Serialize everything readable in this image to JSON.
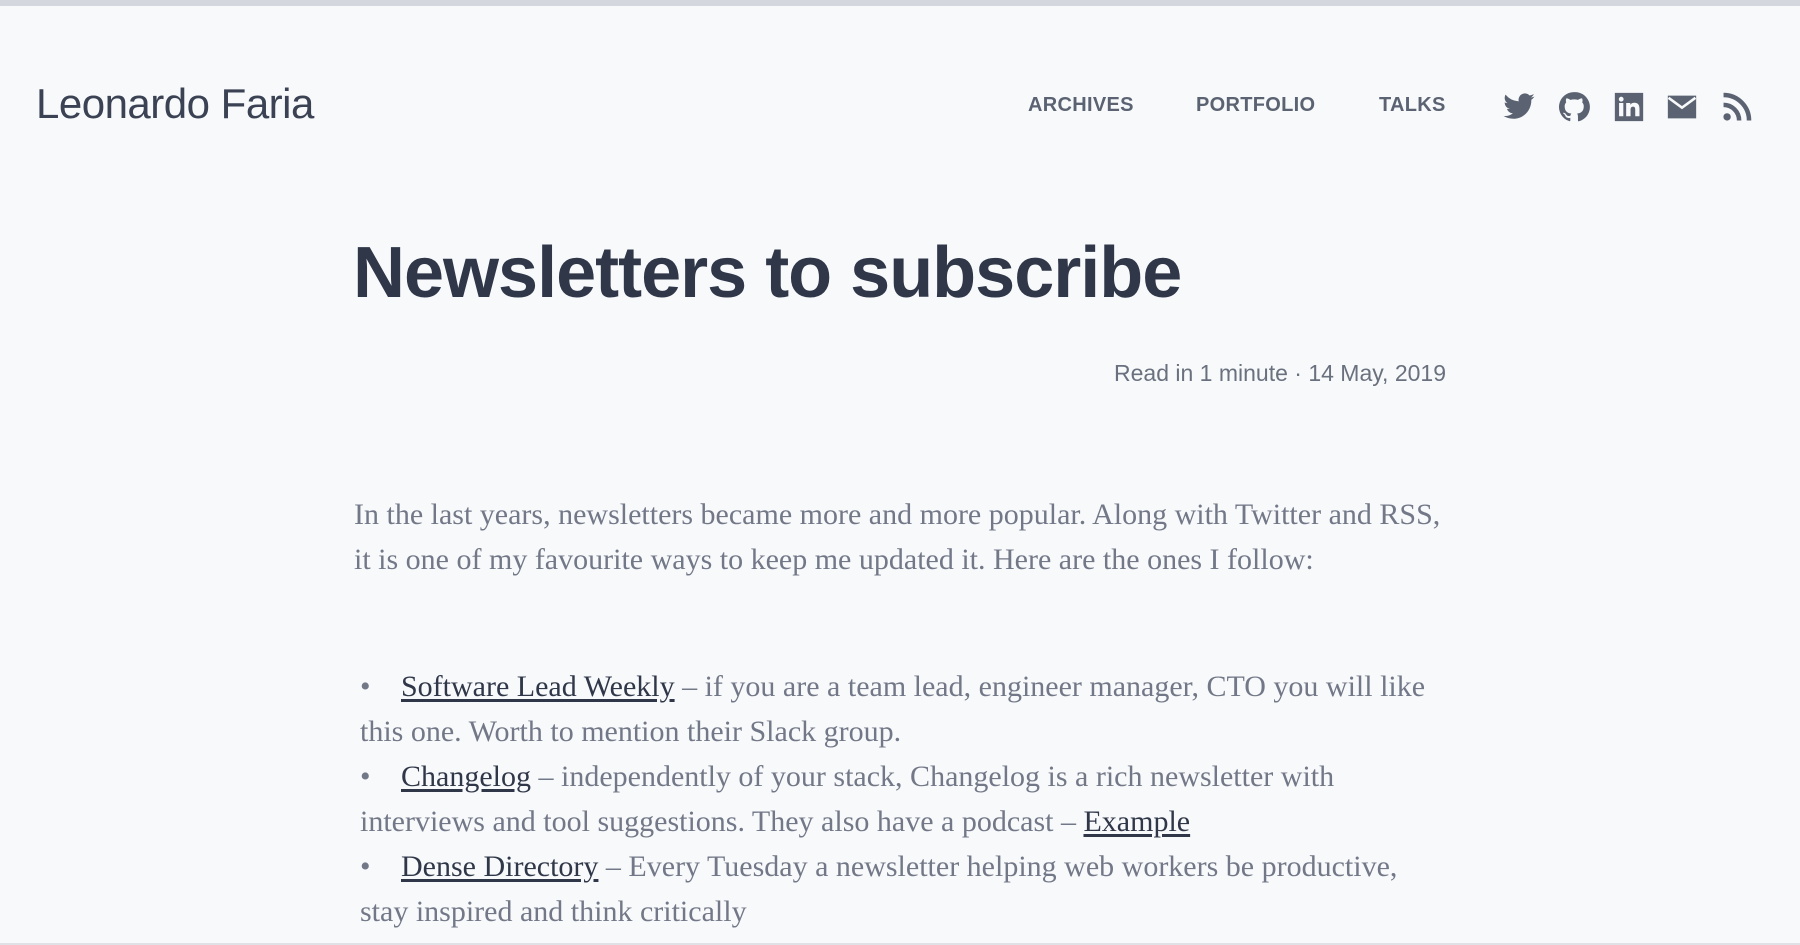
{
  "site": {
    "title": "Leonardo Faria"
  },
  "nav": {
    "archives": "ARCHIVES",
    "portfolio": "PORTFOLIO",
    "talks": "TALKS"
  },
  "social": [
    {
      "icon": "twitter-icon"
    },
    {
      "icon": "github-icon"
    },
    {
      "icon": "linkedin-icon"
    },
    {
      "icon": "mail-icon"
    },
    {
      "icon": "rss-icon"
    }
  ],
  "post": {
    "title": "Newsletters to subscribe",
    "meta": "Read in 1 minute · 14 May, 2019",
    "intro": "In the last years, newsletters became more and more popular. Along with Twitter and RSS, it is one of my favourite ways to keep me updated it. Here are the ones I follow:",
    "items": [
      {
        "link": "Software Lead Weekly",
        "text": " – if you are a team lead, engineer manager, CTO you will like this one. Worth to mention their Slack group."
      },
      {
        "link": "Changelog",
        "text": " – independently of your stack, Changelog is a rich newsletter with interviews and tool suggestions. They also have a podcast – ",
        "extra_link": "Example"
      },
      {
        "link": "Dense Directory",
        "text": " – Every Tuesday a newsletter helping web workers be productive, stay inspired and think critically"
      }
    ]
  },
  "colors": {
    "background": "#f8f9fb",
    "heading": "#2f3748",
    "body_text": "#727887",
    "nav_text": "#5b6372"
  }
}
